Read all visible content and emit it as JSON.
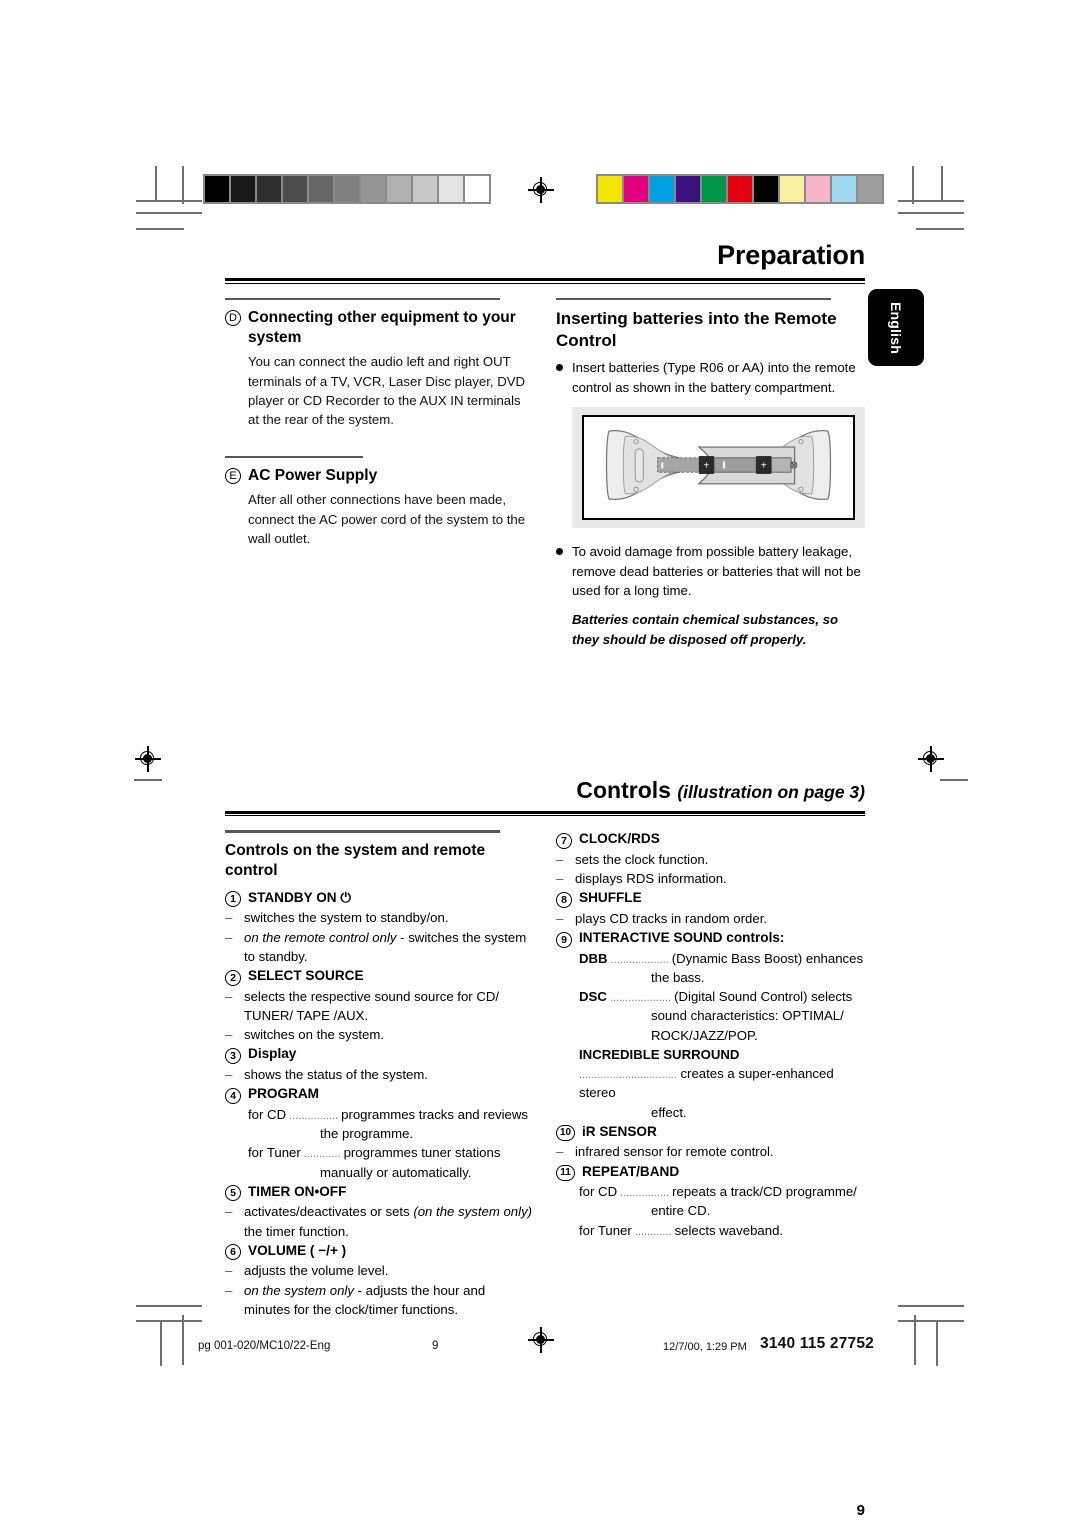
{
  "document": {
    "header_title": "Preparation",
    "language_tab": "English",
    "page_number": "9"
  },
  "preparation": {
    "left_column": {
      "section_d": {
        "marker": "D",
        "heading": "Connecting other equipment to your system",
        "body": "You can connect the audio left and right OUT terminals of a  TV, VCR, Laser Disc player, DVD player or CD Recorder to the AUX IN terminals at the rear of the system."
      },
      "section_e": {
        "marker": "E",
        "heading": "AC Power Supply",
        "body": "After all other connections have been made, connect the AC power cord of the system to the wall outlet."
      }
    },
    "right_column": {
      "heading": "Inserting batteries into the Remote Control",
      "bullet_1": "Insert batteries (Type R06 or AA) into the remote control as shown in the battery compartment.",
      "figure_name": "remote-control-battery-compartment",
      "bullet_2": "To avoid damage from possible battery leakage, remove dead batteries or batteries that will not be used for a long time.",
      "warning": "Batteries contain chemical substances, so they should be disposed off properly."
    }
  },
  "controls": {
    "title_main": "Controls",
    "title_sub": "(illustration on page 3)",
    "left_column": {
      "heading": "Controls on the system and remote control",
      "items": [
        {
          "number": "1",
          "label": "STANDBY ON",
          "symbol": "⏻",
          "lines": [
            {
              "dash": "–",
              "text": "switches the system to standby/on."
            },
            {
              "dash": "–",
              "italic_lead": "on the remote control only",
              "text": " - switches the system to standby."
            }
          ]
        },
        {
          "number": "2",
          "label": "SELECT SOURCE",
          "lines": [
            {
              "dash": "–",
              "text": "selects the respective sound source for CD/ TUNER/ TAPE /AUX."
            },
            {
              "dash": "–",
              "text": "switches on the system."
            }
          ]
        },
        {
          "number": "3",
          "label": "Display",
          "label_style": "mixed",
          "lines": [
            {
              "dash": "–",
              "text": "shows the status of the system."
            }
          ]
        },
        {
          "number": "4",
          "label": "PROGRAM",
          "sub_entries": [
            {
              "key": "for CD",
              "dots": "................",
              "text": "programmes tracks and reviews",
              "cont": "the programme."
            },
            {
              "key": "for Tuner",
              "dots": "............",
              "text": "programmes tuner stations",
              "cont": "manually or automatically."
            }
          ]
        },
        {
          "number": "5",
          "label": "TIMER ON•OFF",
          "lines": [
            {
              "dash": "–",
              "text": "activates/deactivates or sets ",
              "italic_trail": "(on the system only)",
              "text_after": " the timer function."
            }
          ]
        },
        {
          "number": "6",
          "label": "VOLUME ( −/+ )",
          "lines": [
            {
              "dash": "–",
              "text": "adjusts the volume level."
            },
            {
              "dash": "–",
              "italic_lead": "on the system only",
              "text": " - adjusts the hour and minutes for the clock/timer functions."
            }
          ]
        }
      ]
    },
    "right_column": {
      "items": [
        {
          "number": "7",
          "label": "CLOCK/RDS",
          "lines": [
            {
              "dash": "–",
              "text": "sets the clock function."
            },
            {
              "dash": "–",
              "text": "displays RDS information."
            }
          ]
        },
        {
          "number": "8",
          "label": "SHUFFLE",
          "lines": [
            {
              "dash": "–",
              "text": "plays CD tracks in random order."
            }
          ]
        },
        {
          "number": "9",
          "label": "INTERACTIVE SOUND",
          "label_tail": " controls:",
          "sub_entries": [
            {
              "key": "DBB",
              "bold": true,
              "dots": "...................",
              "text": "(Dynamic Bass Boost) enhances",
              "cont": "the bass."
            },
            {
              "key": "DSC",
              "bold": true,
              "dots": "....................",
              "text": "(Digital Sound Control) selects",
              "cont": "sound characteristics: OPTIMAL/ ROCK/JAZZ/POP."
            },
            {
              "key": "INCREDIBLE SURROUND",
              "bold": true,
              "block": true,
              "dots": "................................",
              "text": "creates a super-enhanced stereo",
              "cont": "effect."
            }
          ]
        },
        {
          "number": "10",
          "label": "iR SENSOR",
          "lines": [
            {
              "dash": "–",
              "text": "infrared sensor for remote control."
            }
          ]
        },
        {
          "number": "11",
          "label": "REPEAT/BAND",
          "sub_entries": [
            {
              "key": "for CD",
              "dots": "................",
              "text": "repeats a track/CD programme/",
              "cont": "entire CD."
            },
            {
              "key": "for Tuner",
              "dots": "............",
              "text": "selects waveband."
            }
          ]
        }
      ]
    }
  },
  "footer": {
    "file_label": "pg 001-020/MC10/22-Eng",
    "page_mark": "9",
    "timestamp": "12/7/00, 1:29 PM",
    "doc_code": "3140 115 27752"
  },
  "calibration": {
    "grayscale_swatches": [
      "#000000",
      "#1a1a1a",
      "#303030",
      "#4d4d4d",
      "#666666",
      "#808080",
      "#969696",
      "#b0b0b0",
      "#c8c8c8",
      "#e4e4e4",
      "#ffffff"
    ],
    "color_swatches": [
      "#f2e600",
      "#e2007f",
      "#00a0e2",
      "#3c1280",
      "#00974b",
      "#e3000f",
      "#000000",
      "#fbf0a0",
      "#f7b5cc",
      "#a0d8f4",
      "#9e9e9e"
    ]
  }
}
